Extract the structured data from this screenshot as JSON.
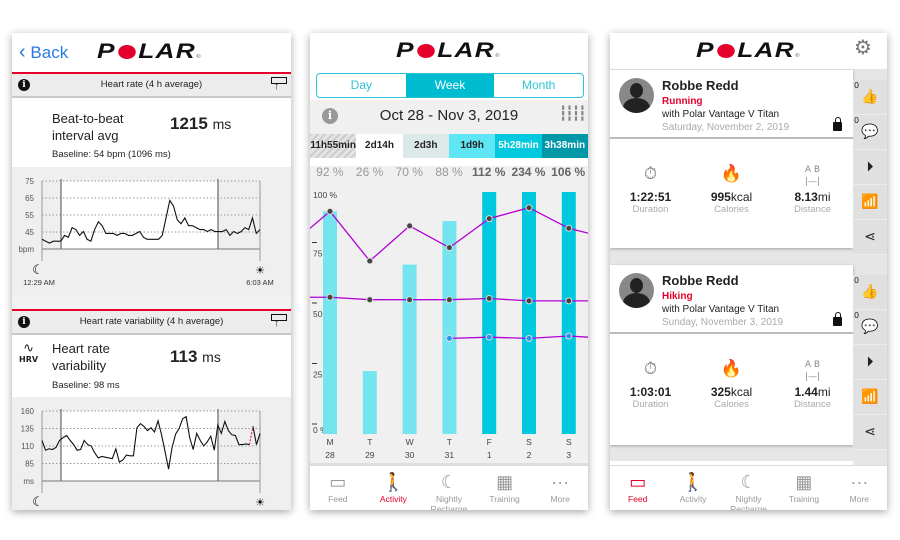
{
  "brand": {
    "logo": "POLAR",
    "accent": "#e4002b",
    "cyan": "#00c8de"
  },
  "screen1": {
    "back_label": "Back",
    "hr": {
      "section_title": "Heart rate (4 h average)",
      "metric_line1": "Beat-to-beat",
      "metric_line2": "interval avg",
      "value": "1215",
      "unit": "ms",
      "baseline": "Baseline: 54 bpm (1096 ms)",
      "y_ticks": [
        "75",
        "65",
        "55",
        "45"
      ],
      "y_unit": "bpm",
      "start_time": "12:29 AM",
      "end_time": "6:03 AM",
      "values": [
        45,
        44,
        43,
        44,
        44,
        44,
        47,
        46,
        51,
        50,
        47,
        49,
        45,
        44,
        50,
        54,
        52,
        48,
        48,
        48,
        47,
        48,
        48,
        47,
        47,
        48,
        49,
        46,
        45,
        45,
        45,
        45,
        47,
        56,
        65,
        62,
        55,
        53,
        56,
        52,
        52,
        51,
        50,
        50,
        49,
        50,
        49,
        49,
        49,
        50,
        47,
        49,
        48,
        49,
        51,
        50,
        56,
        48,
        50
      ]
    },
    "hrv": {
      "section_title": "Heart rate variability (4 h average)",
      "icon_label": "HRV",
      "metric_line1": "Heart rate",
      "metric_line2": "variability",
      "value": "113",
      "unit": "ms",
      "baseline": "Baseline: 98 ms",
      "y_ticks": [
        "160",
        "135",
        "110",
        "85"
      ],
      "y_unit": "ms",
      "values": [
        118,
        104,
        106,
        105,
        108,
        118,
        122,
        125,
        118,
        112,
        104,
        105,
        118,
        112,
        110,
        100,
        93,
        95,
        94,
        93,
        92,
        106,
        87,
        90,
        97,
        96,
        96,
        136,
        142,
        138,
        132,
        136,
        130,
        146,
        126,
        102,
        77,
        108,
        127,
        135,
        149,
        152,
        122,
        105,
        128,
        118,
        110,
        116,
        124,
        104,
        140,
        128,
        145,
        132,
        126,
        125,
        112,
        112,
        113,
        112,
        138,
        112,
        128
      ]
    }
  },
  "screen2": {
    "tabs": [
      {
        "label": "Day"
      },
      {
        "label": "Week"
      },
      {
        "label": "Month"
      }
    ],
    "date_range": "Oct 28 - Nov 3, 2019",
    "durations": [
      "11h55min",
      "2d14h",
      "2d3h",
      "1d9h",
      "5h28min",
      "3h38min"
    ],
    "duration_colors": [
      "#d9d9d9",
      "#ffffff",
      "#dde8ea",
      "#5ee6f5",
      "#00c8de",
      "#0097a7"
    ],
    "percentages": [
      "92 %",
      "26 %",
      "70 %",
      "88 %",
      "112 %",
      "234 %",
      "106 %"
    ],
    "chart_data": {
      "type": "bar",
      "categories": [
        "M 28",
        "T 29",
        "W 30",
        "T 31",
        "F 1",
        "S 2",
        "S 3"
      ],
      "day_letters": [
        "M",
        "T",
        "W",
        "T",
        "F",
        "S",
        "S"
      ],
      "day_numbers": [
        "28",
        "29",
        "30",
        "31",
        "1",
        "2",
        "3"
      ],
      "values": [
        92,
        26,
        70,
        88,
        112,
        234,
        106
      ],
      "ylim": [
        0,
        100
      ],
      "y_ticks": [
        "100 %",
        "75 %",
        "50 %",
        "25 %",
        "0 %"
      ],
      "series": [
        {
          "type": "line",
          "values": [
            92,
            71.5,
            86,
            77,
            89,
            93.5,
            85
          ]
        },
        {
          "type": "line",
          "values": [
            56.5,
            55.5,
            55.5,
            55.5,
            56,
            55,
            55
          ]
        },
        {
          "type": "line",
          "values": [
            null,
            null,
            null,
            39.5,
            40,
            39.5,
            40.5
          ]
        }
      ]
    },
    "nav": [
      {
        "label": "Feed"
      },
      {
        "label": "Activity"
      },
      {
        "label": "Nightly Recharge"
      },
      {
        "label": "Training"
      },
      {
        "label": "More"
      }
    ],
    "active_nav": "Activity"
  },
  "screen3": {
    "cards": [
      {
        "name": "Robbe Redd",
        "sport": "Running",
        "device": "with Polar Vantage V Titan",
        "date": "Saturday, November 2, 2019",
        "duration": "1:22:51",
        "calories": "995",
        "calories_unit": "kcal",
        "distance": "8.13",
        "distance_unit": "mi",
        "likes": "0",
        "comments": "0"
      },
      {
        "name": "Robbe Redd",
        "sport": "Hiking",
        "device": "with Polar Vantage V Titan",
        "date": "Sunday, November 3, 2019",
        "duration": "1:03:01",
        "calories": "325",
        "calories_unit": "kcal",
        "distance": "1.44",
        "distance_unit": "mi",
        "likes": "0",
        "comments": "0"
      }
    ],
    "stat_labels": {
      "duration": "Duration",
      "calories": "Calories",
      "distance": "Distance",
      "distance_icon_text": "A B"
    },
    "nav": [
      {
        "label": "Feed"
      },
      {
        "label": "Activity"
      },
      {
        "label": "Nightly Recharge"
      },
      {
        "label": "Training"
      },
      {
        "label": "More"
      }
    ],
    "active_nav": "Feed"
  }
}
